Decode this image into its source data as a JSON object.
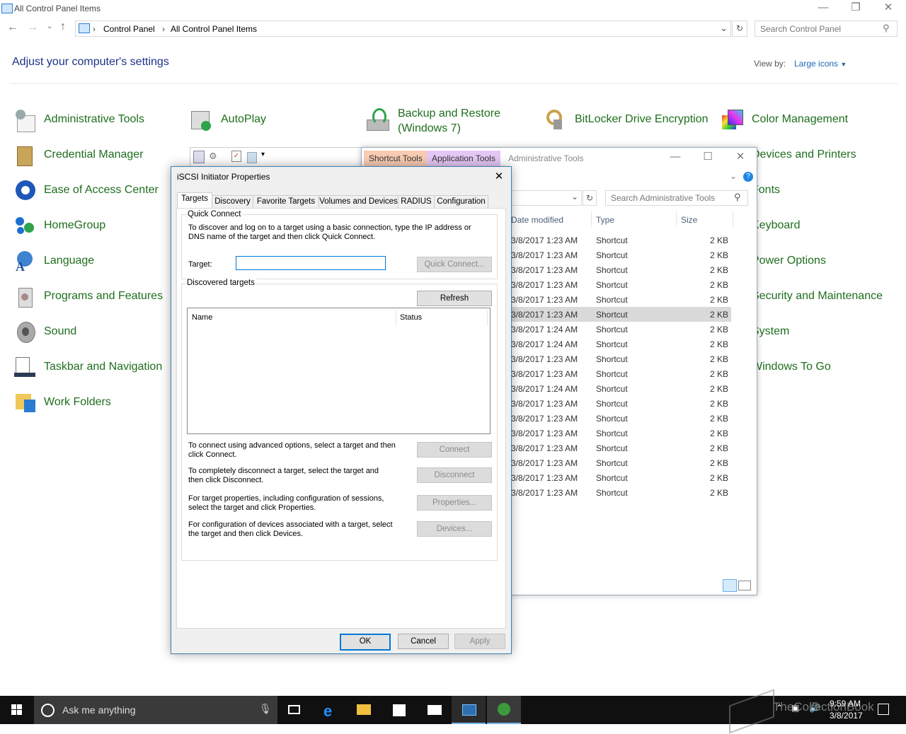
{
  "window": {
    "title": "All Control Panel Items",
    "breadcrumb": [
      "Control Panel",
      "All Control Panel Items"
    ],
    "search_placeholder": "Search Control Panel"
  },
  "header": {
    "heading": "Adjust your computer's settings",
    "view_by_label": "View by:",
    "view_by_value": "Large icons"
  },
  "control_panel_items": [
    {
      "label": "Administrative Tools",
      "icon": "admin-tools-icon"
    },
    {
      "label": "AutoPlay",
      "icon": "autoplay-icon"
    },
    {
      "label": "Backup and Restore\n(Windows 7)",
      "icon": "backup-icon"
    },
    {
      "label": "BitLocker Drive Encryption",
      "icon": "bitlocker-icon"
    },
    {
      "label": "Color Management",
      "icon": "color-management-icon"
    },
    {
      "label": "Credential Manager",
      "icon": "credential-manager-icon"
    },
    {
      "label": "Ease of Access Center",
      "icon": "ease-of-access-icon"
    },
    {
      "label": "HomeGroup",
      "icon": "homegroup-icon"
    },
    {
      "label": "Language",
      "icon": "language-icon"
    },
    {
      "label": "Programs and Features",
      "icon": "programs-icon"
    },
    {
      "label": "Sound",
      "icon": "sound-icon"
    },
    {
      "label": "Taskbar and Navigation",
      "icon": "taskbar-icon"
    },
    {
      "label": "Work Folders",
      "icon": "work-folders-icon"
    },
    {
      "label": "Devices and Printers",
      "icon": ""
    },
    {
      "label": "Fonts",
      "icon": ""
    },
    {
      "label": "Keyboard",
      "icon": ""
    },
    {
      "label": "Power Options",
      "icon": ""
    },
    {
      "label": "Security and Maintenance",
      "icon": ""
    },
    {
      "label": "System",
      "icon": ""
    },
    {
      "label": "Windows To Go",
      "icon": ""
    }
  ],
  "explorer": {
    "title": "Administrative Tools",
    "context_tabs": [
      "Shortcut Tools",
      "Application Tools"
    ],
    "search_placeholder": "Search Administrative Tools",
    "columns": [
      "Date modified",
      "Type",
      "Size"
    ],
    "rows": [
      {
        "date": "3/8/2017 1:23 AM",
        "type": "Shortcut",
        "size": "2 KB"
      },
      {
        "date": "3/8/2017 1:23 AM",
        "type": "Shortcut",
        "size": "2 KB"
      },
      {
        "date": "3/8/2017 1:23 AM",
        "type": "Shortcut",
        "size": "2 KB"
      },
      {
        "date": "3/8/2017 1:23 AM",
        "type": "Shortcut",
        "size": "2 KB"
      },
      {
        "date": "3/8/2017 1:23 AM",
        "type": "Shortcut",
        "size": "2 KB"
      },
      {
        "date": "3/8/2017 1:23 AM",
        "type": "Shortcut",
        "size": "2 KB",
        "selected": true
      },
      {
        "date": "3/8/2017 1:24 AM",
        "type": "Shortcut",
        "size": "2 KB"
      },
      {
        "date": "3/8/2017 1:24 AM",
        "type": "Shortcut",
        "size": "2 KB"
      },
      {
        "date": "3/8/2017 1:23 AM",
        "type": "Shortcut",
        "size": "2 KB"
      },
      {
        "date": "3/8/2017 1:23 AM",
        "type": "Shortcut",
        "size": "2 KB"
      },
      {
        "date": "3/8/2017 1:24 AM",
        "type": "Shortcut",
        "size": "2 KB"
      },
      {
        "date": "3/8/2017 1:23 AM",
        "type": "Shortcut",
        "size": "2 KB"
      },
      {
        "date": "3/8/2017 1:23 AM",
        "type": "Shortcut",
        "size": "2 KB"
      },
      {
        "date": "3/8/2017 1:23 AM",
        "type": "Shortcut",
        "size": "2 KB"
      },
      {
        "date": "3/8/2017 1:23 AM",
        "type": "Shortcut",
        "size": "2 KB"
      },
      {
        "date": "3/8/2017 1:23 AM",
        "type": "Shortcut",
        "size": "2 KB"
      },
      {
        "date": "3/8/2017 1:23 AM",
        "type": "Shortcut",
        "size": "2 KB"
      },
      {
        "date": "3/8/2017 1:23 AM",
        "type": "Shortcut",
        "size": "2 KB"
      }
    ]
  },
  "dialog": {
    "title": "iSCSI Initiator Properties",
    "tabs": [
      "Targets",
      "Discovery",
      "Favorite Targets",
      "Volumes and Devices",
      "RADIUS",
      "Configuration"
    ],
    "active_tab": "Targets",
    "quick_connect": {
      "group_label": "Quick Connect",
      "description": "To discover and log on to a target using a basic connection, type the IP address or DNS name of the target and then click Quick Connect.",
      "target_label": "Target:",
      "target_value": "",
      "button": "Quick Connect..."
    },
    "discovered": {
      "group_label": "Discovered targets",
      "refresh_button": "Refresh",
      "columns": [
        "Name",
        "Status"
      ]
    },
    "actions": [
      {
        "text": "To connect using advanced options, select a target and then click Connect.",
        "button": "Connect"
      },
      {
        "text": "To completely disconnect a target, select the target and then click Disconnect.",
        "button": "Disconnect"
      },
      {
        "text": "For target properties, including configuration of sessions, select the target and click Properties.",
        "button": "Properties..."
      },
      {
        "text": "For configuration of devices associated with a target, select the target and then click Devices.",
        "button": "Devices..."
      }
    ],
    "ok": "OK",
    "cancel": "Cancel",
    "apply": "Apply"
  },
  "taskbar": {
    "search_placeholder": "Ask me anything",
    "time": "9:59 AM",
    "date": "3/8/2017",
    "watermark": "TheCollectionBook"
  },
  "colors": {
    "link_green": "#1e6e1e",
    "heading_blue": "#1e3287",
    "dialog_border": "#3c7fb1",
    "shortcut_tools_tab": "#f9cbb2",
    "application_tools_tab": "#e5c7f5",
    "taskbar": "#101010"
  }
}
